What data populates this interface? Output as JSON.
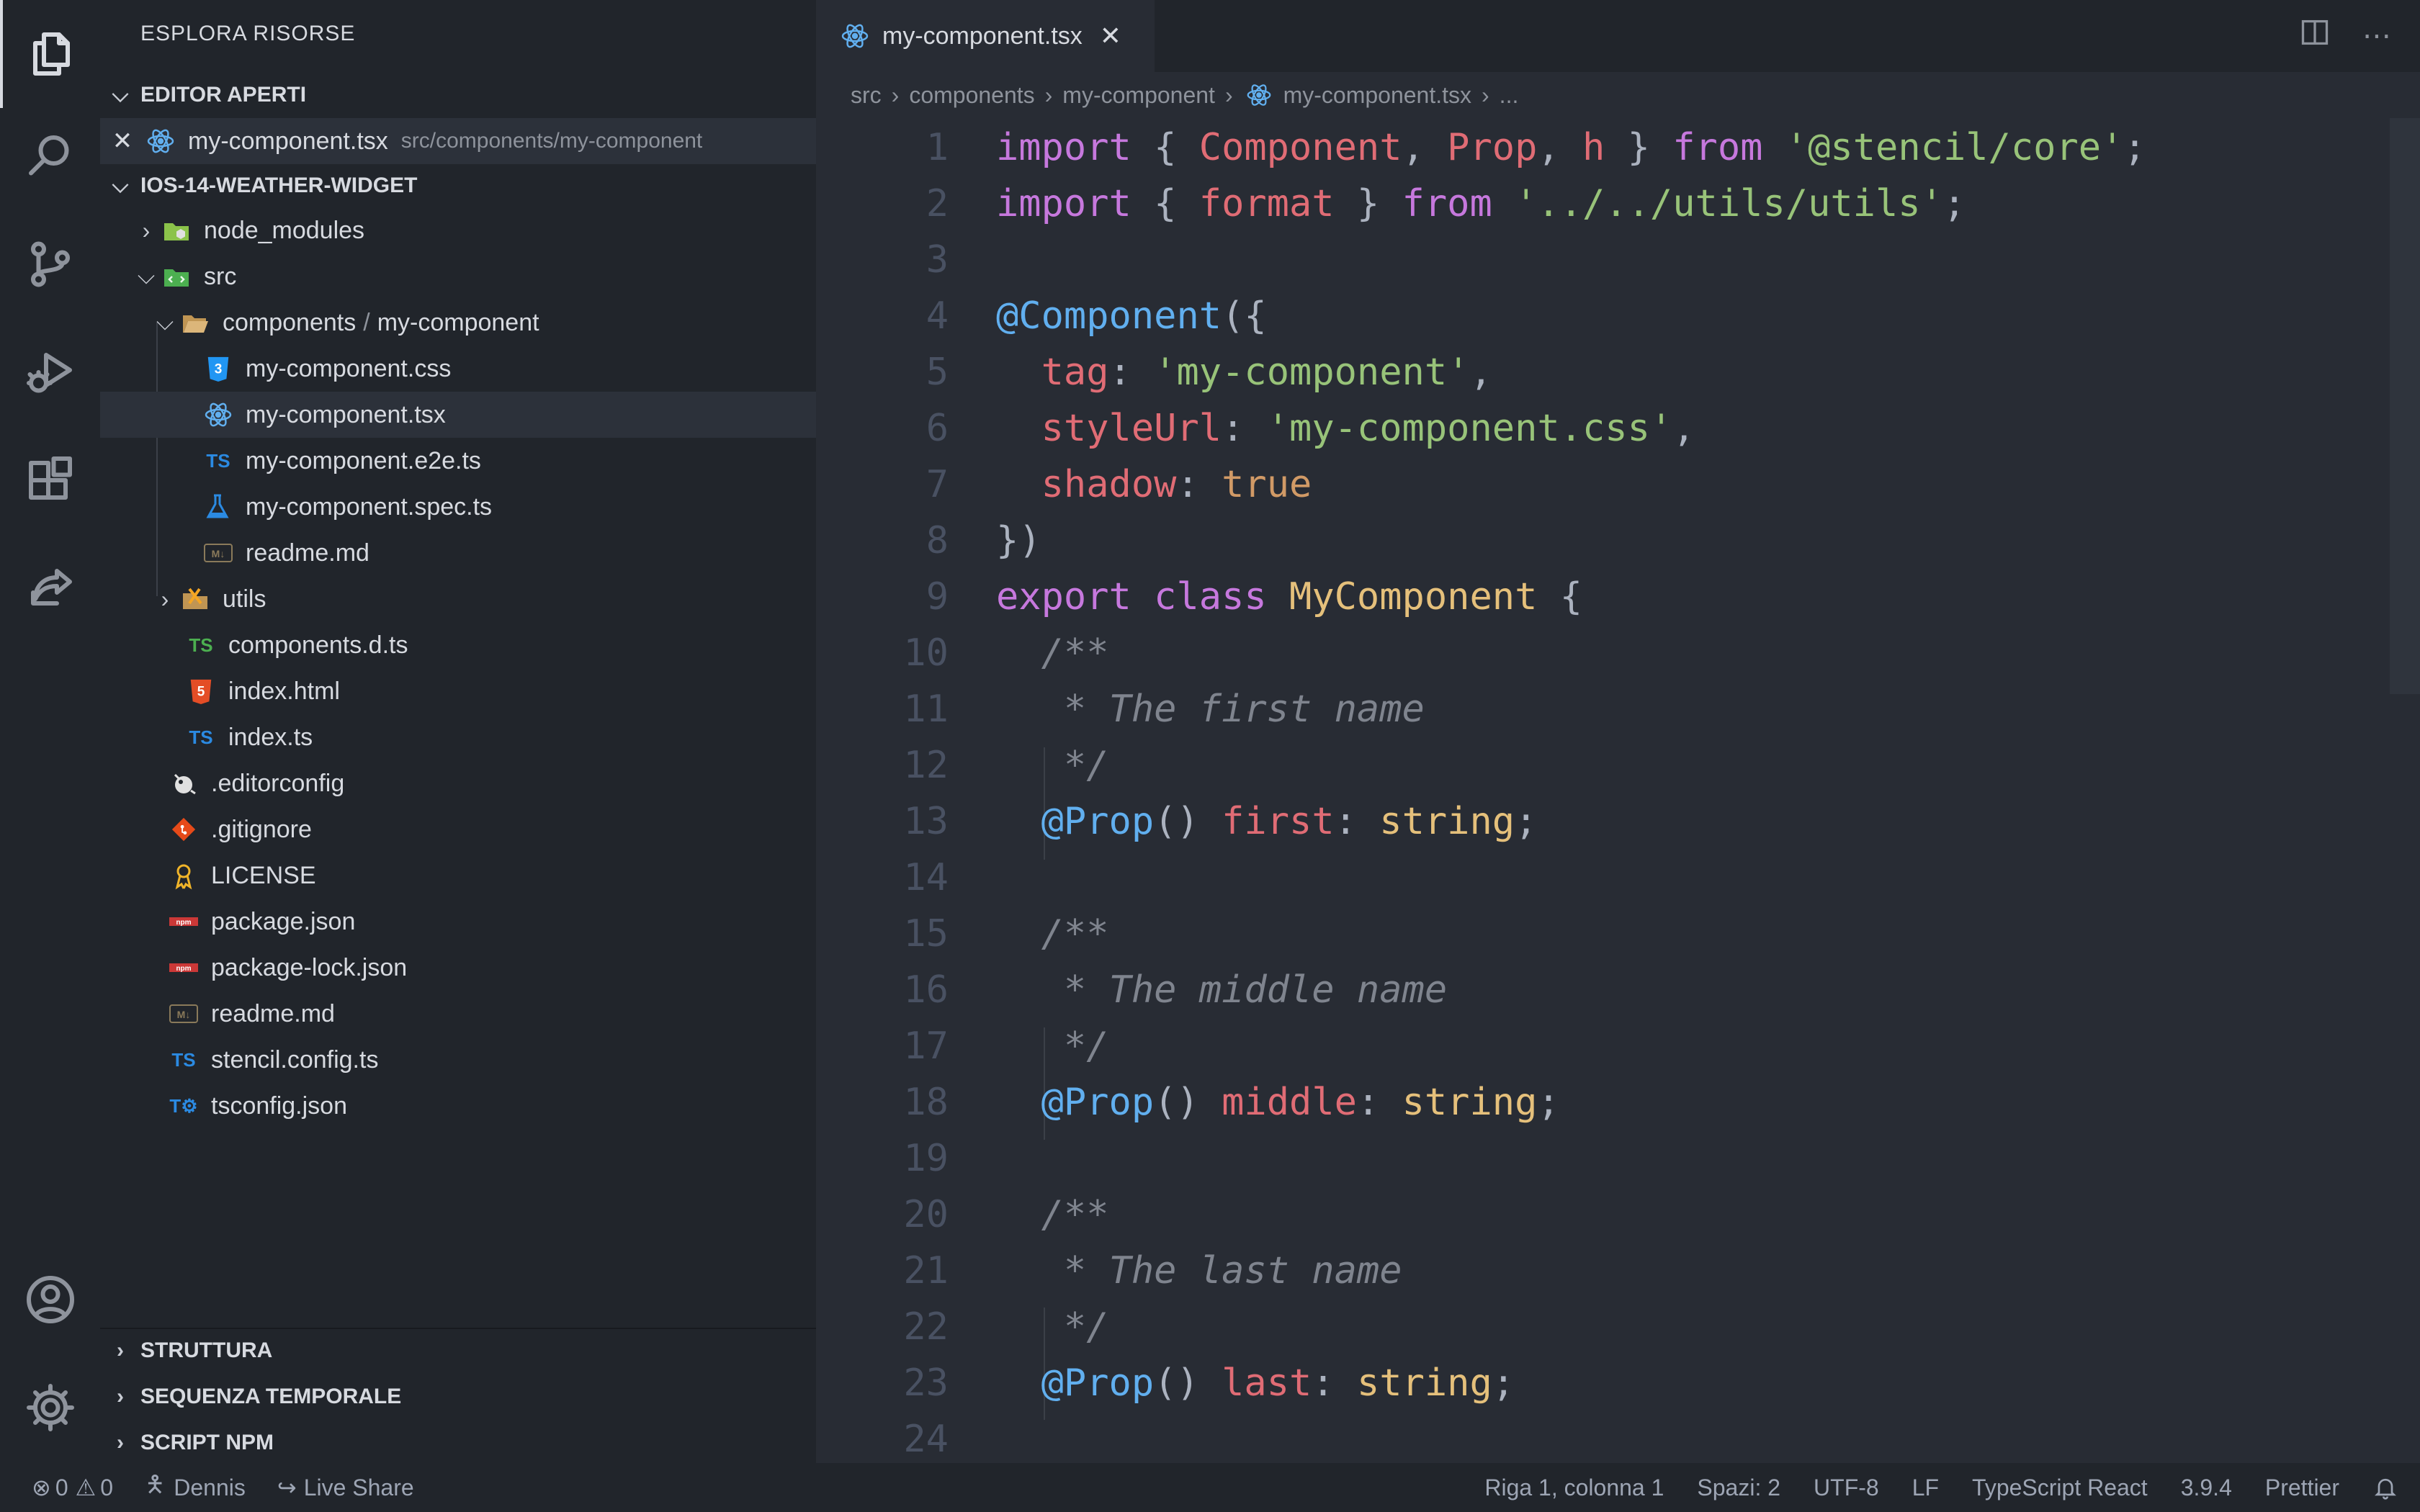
{
  "activity_bar": {
    "items": [
      "files-icon",
      "search-icon",
      "source-control-icon",
      "run-debug-icon",
      "extensions-icon",
      "live-share-icon"
    ],
    "bottom": [
      "account-icon",
      "settings-gear-icon"
    ]
  },
  "sidebar": {
    "title": "ESPLORA RISORSE",
    "open_editors": {
      "header": "EDITOR APERTI",
      "items": [
        {
          "name": "my-component.tsx",
          "path": "src/components/my-component"
        }
      ]
    },
    "project": {
      "header": "IOS-14-WEATHER-WIDGET",
      "tree": {
        "node_modules": "node_modules",
        "src": "src",
        "components": "components",
        "components_sep": "/",
        "my_component": "my-component",
        "files": {
          "css": "my-component.css",
          "tsx": "my-component.tsx",
          "e2e": "my-component.e2e.ts",
          "spec": "my-component.spec.ts",
          "readme": "readme.md"
        },
        "utils": "utils",
        "components_d_ts": "components.d.ts",
        "index_html": "index.html",
        "index_ts": "index.ts",
        "root_files": {
          "editorconfig": ".editorconfig",
          "gitignore": ".gitignore",
          "license": "LICENSE",
          "package_json": "package.json",
          "package_lock": "package-lock.json",
          "readme": "readme.md",
          "stencil_config": "stencil.config.ts",
          "tsconfig": "tsconfig.json"
        }
      }
    },
    "bottom_sections": [
      "STRUTTURA",
      "SEQUENZA TEMPORALE",
      "SCRIPT NPM"
    ]
  },
  "tab": {
    "label": "my-component.tsx",
    "close": "✕"
  },
  "tab_actions": {
    "split": "split-editor-icon",
    "more": "⋯"
  },
  "breadcrumb": {
    "parts": [
      "src",
      "components",
      "my-component",
      "my-component.tsx",
      "..."
    ],
    "separator": "›"
  },
  "editor": {
    "line_numbers": [
      "1",
      "2",
      "3",
      "4",
      "5",
      "6",
      "7",
      "8",
      "9",
      "10",
      "11",
      "12",
      "13",
      "14",
      "15",
      "16",
      "17",
      "18",
      "19",
      "20",
      "21",
      "22",
      "23",
      "24"
    ],
    "tokens": {
      "import": "import",
      "from": "from",
      "Component": "Component",
      "Prop": "Prop",
      "h": "h",
      "format": "format",
      "stencil_core": "'@stencil/core'",
      "utils_path": "'../../utils/utils'",
      "at_component": "@Component",
      "tag": "tag",
      "tag_val": "'my-component'",
      "styleUrl": "styleUrl",
      "style_val": "'my-component.css'",
      "shadow": "shadow",
      "true": "true",
      "export": "export",
      "class": "class",
      "MyComponent": "MyComponent",
      "cm_open": "/**",
      "cm_close": "*/",
      "cm_first": "* The first name",
      "cm_middle": "* The middle name",
      "cm_last": "* The last name",
      "at_prop": "@Prop",
      "first": "first",
      "middle": "middle",
      "last": "last",
      "string": "string"
    }
  },
  "status_bar": {
    "errors": "0",
    "warnings": "0",
    "user": "Dennis",
    "live_share": "Live Share",
    "position": "Riga 1, colonna 1",
    "spaces": "Spazi: 2",
    "encoding": "UTF-8",
    "eol": "LF",
    "language": "TypeScript React",
    "ts_version": "3.9.4",
    "formatter": "Prettier"
  }
}
